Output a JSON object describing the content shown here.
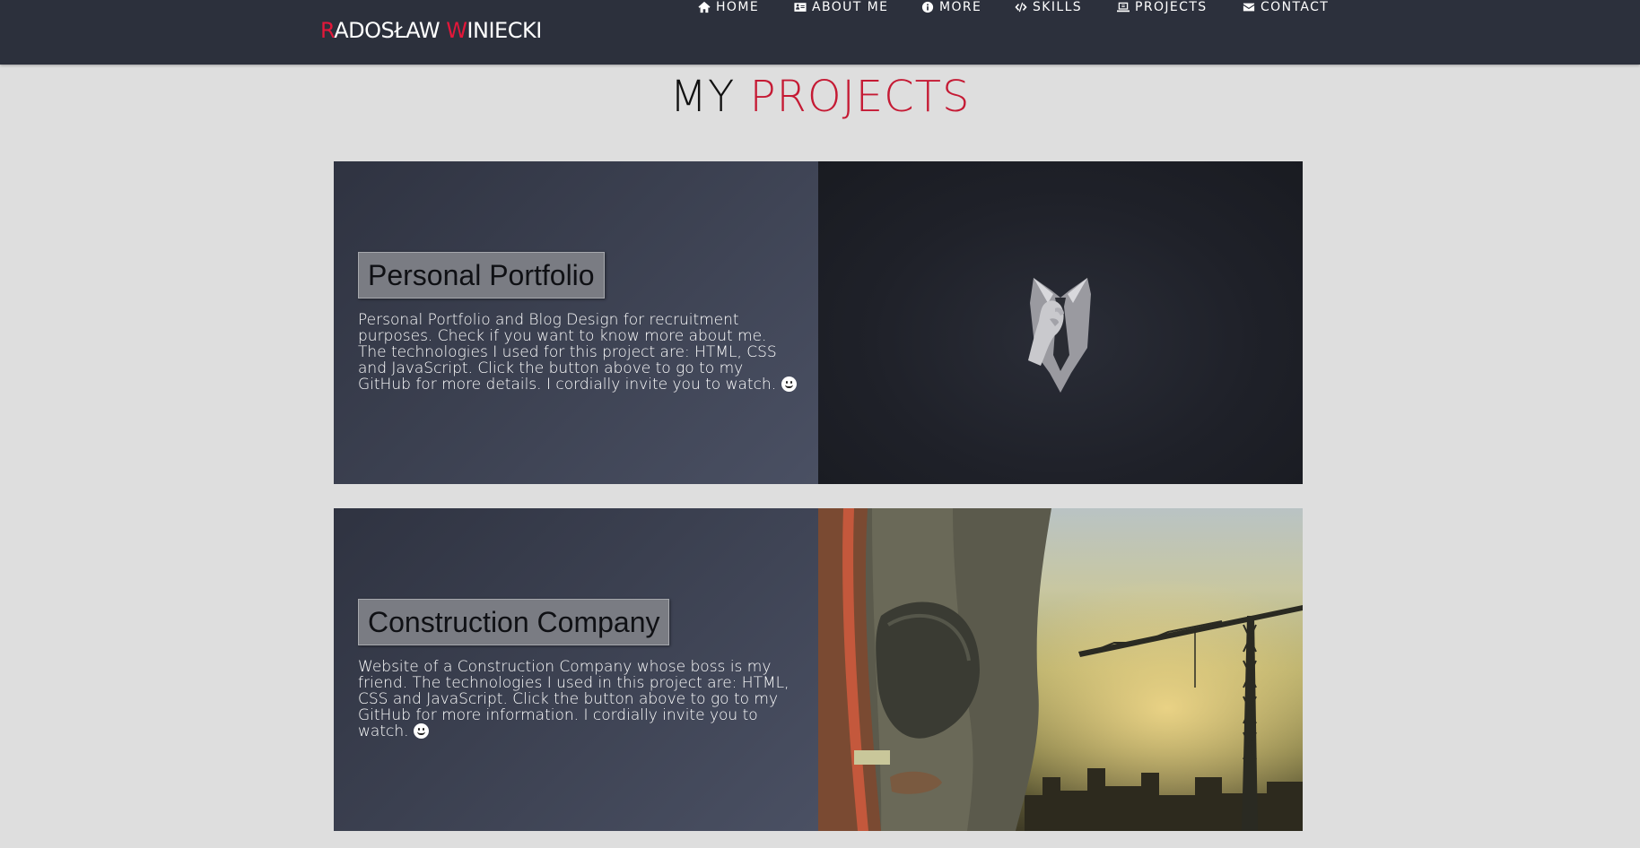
{
  "brand": {
    "first_initial": "R",
    "first_rest": "ADOSŁAW ",
    "last_initial": "W",
    "last_rest": "INIECKI",
    "accent_color": "#e3173a"
  },
  "nav": {
    "items": [
      {
        "label": "HOME",
        "icon": "home-icon"
      },
      {
        "label": "ABOUT ME",
        "icon": "id-card-icon"
      },
      {
        "label": "MORE",
        "icon": "info-circle-icon"
      },
      {
        "label": "SKILLS",
        "icon": "code-icon"
      },
      {
        "label": "PROJECTS",
        "icon": "laptop-icon"
      },
      {
        "label": "CONTACT",
        "icon": "envelope-icon"
      }
    ]
  },
  "section": {
    "title_part1": "MY ",
    "title_part2": "PROJECTS"
  },
  "projects": [
    {
      "button_label": "Personal Portfolio",
      "description": "Personal Portfolio and Blog Design for recruitment purposes. Check if you want to know more about me. The technologies I used for this project are: HTML, CSS and JavaScript. Click the button above to go to my GitHub for more details. I cordially invite you to watch. ",
      "image": "suit-and-tie-figure"
    },
    {
      "button_label": "Construction Company",
      "description": "Website of a Construction Company whose boss is my friend. The technologies I used in this project are: HTML, CSS and JavaScript. Click the button above to go to my GitHub for more information. I cordially invite you to watch. ",
      "image": "construction-worker-and-crane"
    }
  ],
  "colors": {
    "navbar_bg": "#2c303c",
    "page_bg": "#dedede",
    "title_accent": "#c51a34"
  }
}
